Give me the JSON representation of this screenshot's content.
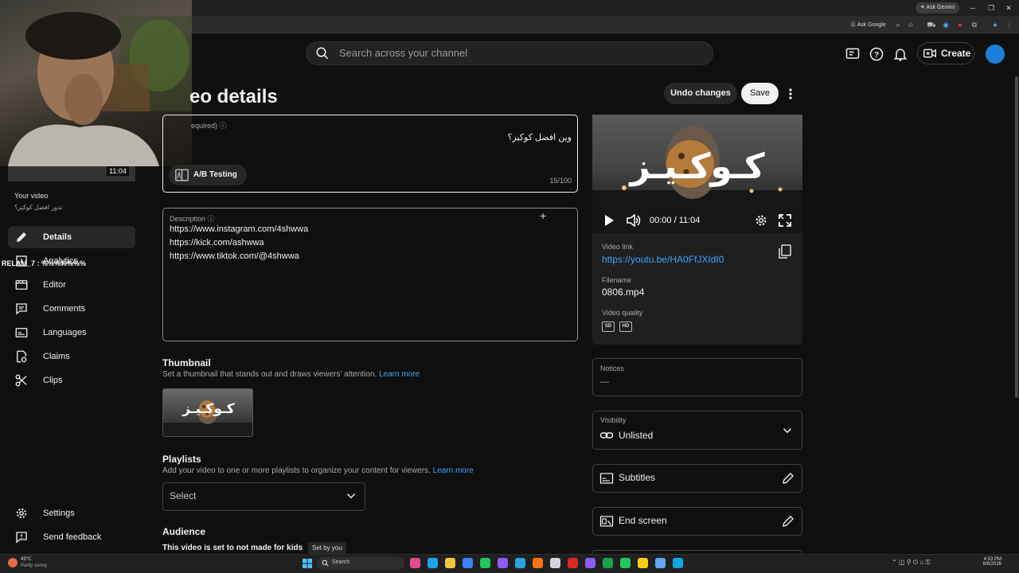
{
  "browser": {
    "gemini_label": "Ask Gemini",
    "ask_google_label": "Ask Google",
    "window_controls": [
      "─",
      "❐",
      "✕"
    ]
  },
  "header": {
    "search_placeholder": "Search across your channel",
    "create_label": "Create"
  },
  "overlay": {
    "text": "RELAM_7 : %%%%%%%"
  },
  "sidebar": {
    "video_duration": "11:04",
    "your_video_label": "Your video",
    "video_title": "تدور افضل كوكيز؟",
    "items": [
      {
        "label": "Details",
        "icon": "pencil-icon",
        "active": true
      },
      {
        "label": "Analytics",
        "icon": "analytics-icon",
        "active": false
      },
      {
        "label": "Editor",
        "icon": "editor-icon",
        "active": false
      },
      {
        "label": "Comments",
        "icon": "comments-icon",
        "active": false
      },
      {
        "label": "Languages",
        "icon": "languages-icon",
        "active": false
      },
      {
        "label": "Claims",
        "icon": "claims-icon",
        "active": false
      },
      {
        "label": "Clips",
        "icon": "scissors-icon",
        "active": false
      }
    ],
    "bottom_items": [
      {
        "label": "Settings",
        "icon": "gear-icon"
      },
      {
        "label": "Send feedback",
        "icon": "feedback-icon"
      }
    ]
  },
  "main": {
    "page_title": "eo details",
    "undo_label": "Undo changes",
    "save_label": "Save",
    "title_field": {
      "label": "equired)",
      "value": "وين افضل كوكيز؟",
      "counter": "15/100",
      "ab_testing_label": "A/B Testing"
    },
    "description": {
      "label": "Description",
      "lines": [
        "https://www.instagram.com/4shwwa",
        "https://kick.com/ashwwa",
        "https://www.tiktok.com/@4shwwa"
      ]
    },
    "thumbnail": {
      "heading": "Thumbnail",
      "subtitle": "Set a thumbnail that stands out and draws viewers' attention.",
      "learn_more": "Learn more",
      "overlay_text": "كـوكـيـز"
    },
    "playlists": {
      "heading": "Playlists",
      "subtitle": "Add your video to one or more playlists to organize your content for viewers.",
      "learn_more": "Learn more",
      "select_value": "Select"
    },
    "audience": {
      "heading": "Audience",
      "status": "This video is set to not made for kids",
      "badge": "Set by you"
    }
  },
  "right_panel": {
    "video_overlay_text": "كـوكـيـز",
    "time": "00:00 / 11:04",
    "video_link_label": "Video link",
    "video_link": "https://youtu.be/HA0FfJXIdI0",
    "filename_label": "Filename",
    "filename": "0806.mp4",
    "quality_label": "Video quality",
    "quality_badges": [
      "SD",
      "HD"
    ],
    "notices_label": "Notices",
    "notices_value": "—",
    "visibility_label": "Visibility",
    "visibility_value": "Unlisted",
    "subtitles_label": "Subtitles",
    "end_screen_label": "End screen"
  },
  "taskbar": {
    "temperature": "43°C",
    "weather": "Partly sunny",
    "search_label": "Search",
    "time": "4:53 PM",
    "date": "8/6/2026",
    "app_colors": [
      "#e24c8f",
      "#1fa3e8",
      "#f2c53d",
      "#3b82f6",
      "#22c55e",
      "#8b5cf6",
      "#2aa1e0",
      "#f97316",
      "#d1d5db",
      "#dc2626",
      "#8b5cf6",
      "#16a34a",
      "#22c55e",
      "#facc15",
      "#60a5fa",
      "#0ea5e9"
    ]
  }
}
